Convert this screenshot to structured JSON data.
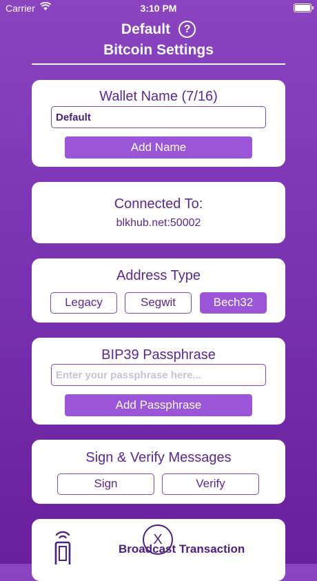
{
  "status_bar": {
    "carrier": "Carrier",
    "time": "3:10 PM"
  },
  "header": {
    "title": "Default",
    "subtitle": "Bitcoin Settings"
  },
  "wallet_name": {
    "title": "Wallet Name (7/16)",
    "value": "Default",
    "button_label": "Add Name"
  },
  "connection": {
    "title": "Connected To:",
    "server": "blkhub.net:50002"
  },
  "address_type": {
    "title": "Address Type",
    "options": [
      "Legacy",
      "Segwit",
      "Bech32"
    ],
    "selected": "Bech32"
  },
  "passphrase": {
    "title": "BIP39 Passphrase",
    "placeholder": "Enter your passphrase here...",
    "button_label": "Add Passphrase"
  },
  "sign_verify": {
    "title": "Sign & Verify Messages",
    "sign_label": "Sign",
    "verify_label": "Verify"
  },
  "broadcast": {
    "label": "Broadcast Transaction"
  },
  "close_button": {
    "label": "X"
  },
  "colors": {
    "accent": "#9a56d6",
    "text_purple": "#5b2792",
    "background": "#7a34b2"
  },
  "icons": [
    "wifi-icon",
    "battery-icon",
    "help-icon",
    "nfc-phone-icon",
    "close-icon"
  ]
}
